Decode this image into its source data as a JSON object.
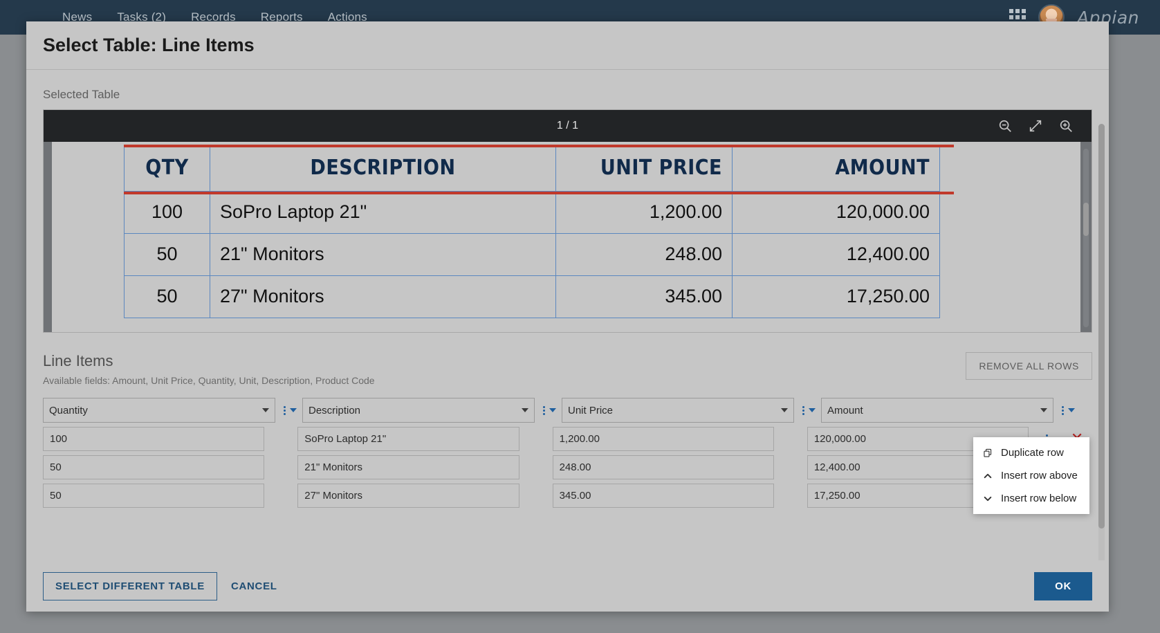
{
  "topnav": {
    "links": [
      "News",
      "Tasks (2)",
      "Records",
      "Reports",
      "Actions"
    ],
    "grid_icon": "apps-grid-icon",
    "avatar_icon": "user-avatar",
    "brand": "Appian"
  },
  "dialog": {
    "title": "Select Table: Line Items",
    "selected_table_label": "Selected Table"
  },
  "viewer": {
    "page_count": "1 / 1",
    "tools": [
      {
        "name": "zoom-out-icon",
        "label": "Zoom out"
      },
      {
        "name": "fit-screen-icon",
        "label": "Fit to screen"
      },
      {
        "name": "zoom-in-icon",
        "label": "Zoom in"
      }
    ],
    "invoice": {
      "headers": [
        "QTY",
        "DESCRIPTION",
        "UNIT PRICE",
        "AMOUNT"
      ],
      "rows": [
        {
          "qty": "100",
          "description": "SoPro Laptop 21\"",
          "unit_price": "1,200.00",
          "amount": "120,000.00"
        },
        {
          "qty": "50",
          "description": "21\" Monitors",
          "unit_price": "248.00",
          "amount": "12,400.00"
        },
        {
          "qty": "50",
          "description": "27\" Monitors",
          "unit_price": "345.00",
          "amount": "17,250.00"
        }
      ],
      "highlight_color": "#c0392b",
      "grid_color": "#5b87bf",
      "header_text_color": "#102a4a"
    }
  },
  "line_items": {
    "title": "Line Items",
    "available_fields": "Available fields: Amount, Unit Price, Quantity, Unit, Description, Product Code",
    "remove_all_label": "REMOVE ALL ROWS",
    "columns": [
      {
        "selected": "Quantity"
      },
      {
        "selected": "Description"
      },
      {
        "selected": "Unit Price"
      },
      {
        "selected": "Amount"
      }
    ],
    "column_options": [
      "Amount",
      "Unit Price",
      "Quantity",
      "Unit",
      "Description",
      "Product Code"
    ],
    "rows": [
      {
        "quantity": "100",
        "description": "SoPro Laptop 21\"",
        "unit_price": "1,200.00",
        "amount": "120,000.00"
      },
      {
        "quantity": "50",
        "description": "21\" Monitors",
        "unit_price": "248.00",
        "amount": "12,400.00"
      },
      {
        "quantity": "50",
        "description": "27\" Monitors",
        "unit_price": "345.00",
        "amount": "17,250.00"
      }
    ],
    "delete_icon": "✕"
  },
  "context_menu": {
    "items": [
      {
        "label": "Duplicate row",
        "icon": "duplicate-icon",
        "glyph": "⧉"
      },
      {
        "label": "Insert row above",
        "icon": "chevron-up-icon",
        "glyph": "⌃"
      },
      {
        "label": "Insert row below",
        "icon": "chevron-down-icon",
        "glyph": "⌄"
      }
    ]
  },
  "footer": {
    "select_different_table": "SELECT DIFFERENT TABLE",
    "cancel": "CANCEL",
    "ok": "OK",
    "primary_color": "#1b5a8e"
  }
}
